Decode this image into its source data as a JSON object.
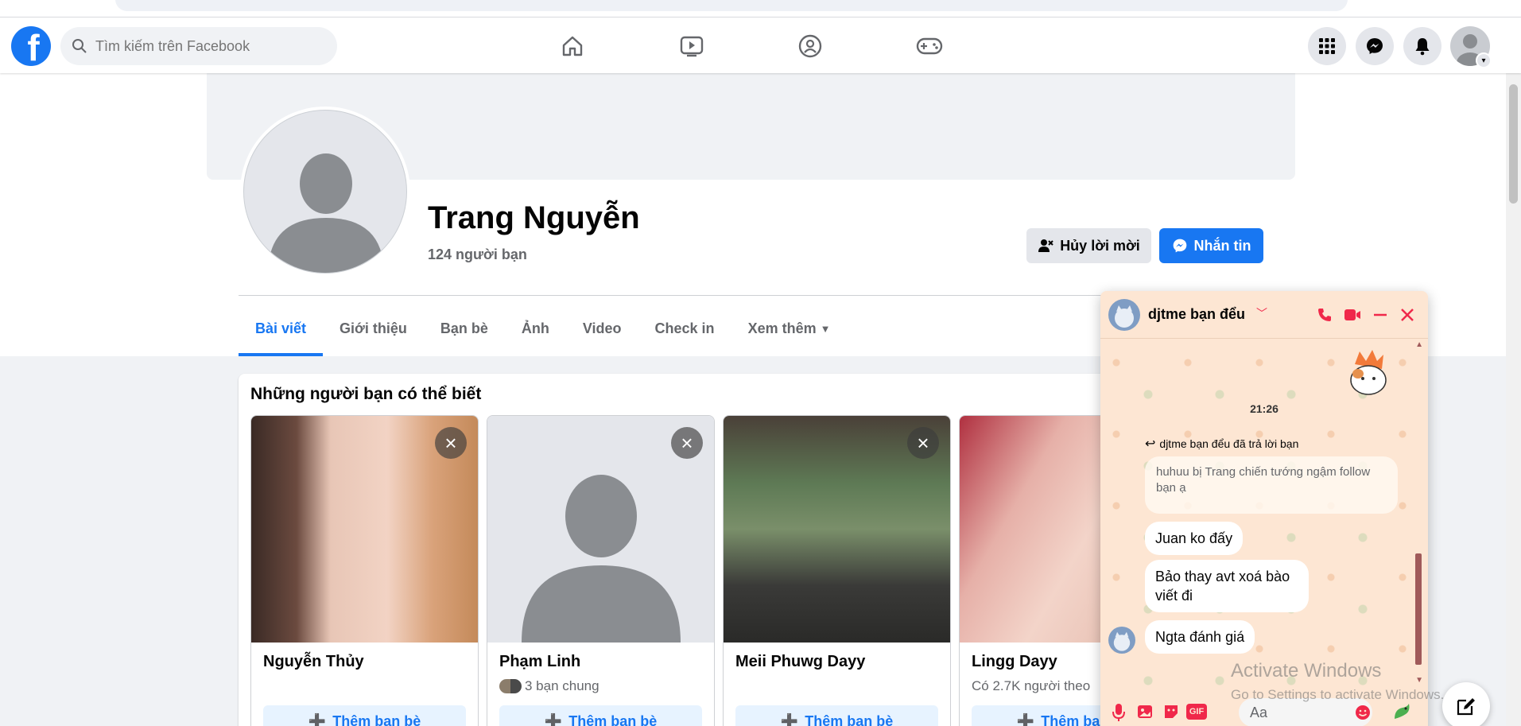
{
  "header": {
    "search_placeholder": "Tìm kiếm trên Facebook"
  },
  "profile": {
    "name": "Trang Nguyễn",
    "friends": "124 người bạn",
    "cancel_request_label": "Hủy lời mời",
    "message_label": "Nhắn tin"
  },
  "tabs": [
    {
      "label": "Bài viết"
    },
    {
      "label": "Giới thiệu"
    },
    {
      "label": "Bạn bè"
    },
    {
      "label": "Ảnh"
    },
    {
      "label": "Video"
    },
    {
      "label": "Check in"
    },
    {
      "label": "Xem thêm"
    }
  ],
  "suggestions": {
    "title": "Những người bạn có thể biết",
    "add_label": "Thêm bạn bè",
    "people": [
      {
        "name": "Nguyễn Thủy",
        "meta": ""
      },
      {
        "name": "Phạm Linh",
        "meta": "3 bạn chung"
      },
      {
        "name": "Meii Phuwg Dayy",
        "meta": ""
      },
      {
        "name": "Lingg Dayy",
        "meta": "Có 2.7K người theo"
      }
    ]
  },
  "chat": {
    "name": "djtme bạn đểu",
    "time": "21:26",
    "reply_note": "djtme bạn đểu đã trả lời bạn",
    "quoted": "huhuu bị Trang chiến tướng ngậm follow bạn ạ",
    "messages": [
      "Juan ko đấy",
      "Bảo thay avt xoá bào viết đi",
      "Ngta đánh giá"
    ],
    "input_placeholder": "Aa"
  },
  "watermark": {
    "title": "Activate Windows",
    "subtitle": "Go to Settings to activate Windows."
  },
  "colors": {
    "brand": "#1877f2",
    "chat_accent": "#f0284a",
    "chat_bg": "#fde6d3"
  }
}
